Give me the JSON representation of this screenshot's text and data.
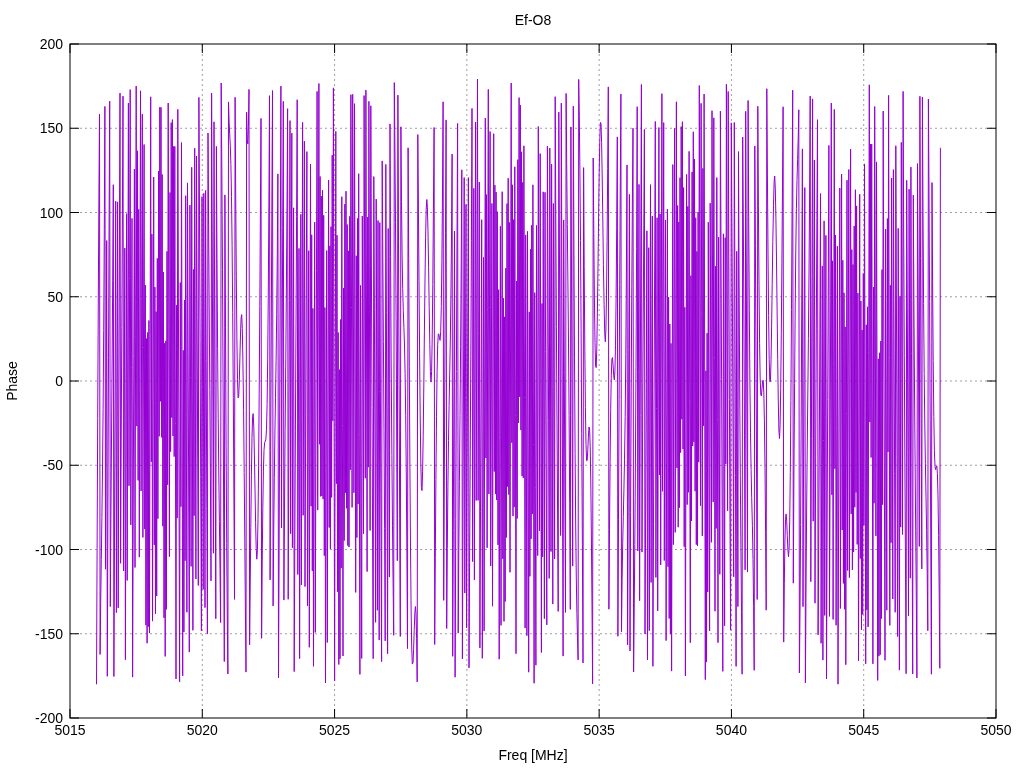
{
  "plot": {
    "chart_data": {
      "type": "line",
      "title": "Ef-O8",
      "xlabel": "Freq [MHz]",
      "ylabel": "Phase",
      "xlim": [
        5015,
        5050
      ],
      "ylim": [
        -200,
        200
      ],
      "xticks": [
        5015,
        5020,
        5025,
        5030,
        5035,
        5040,
        5045,
        5050
      ],
      "yticks": [
        -200,
        -150,
        -100,
        -50,
        0,
        50,
        100,
        150,
        200
      ],
      "grid": true
    }
  }
}
